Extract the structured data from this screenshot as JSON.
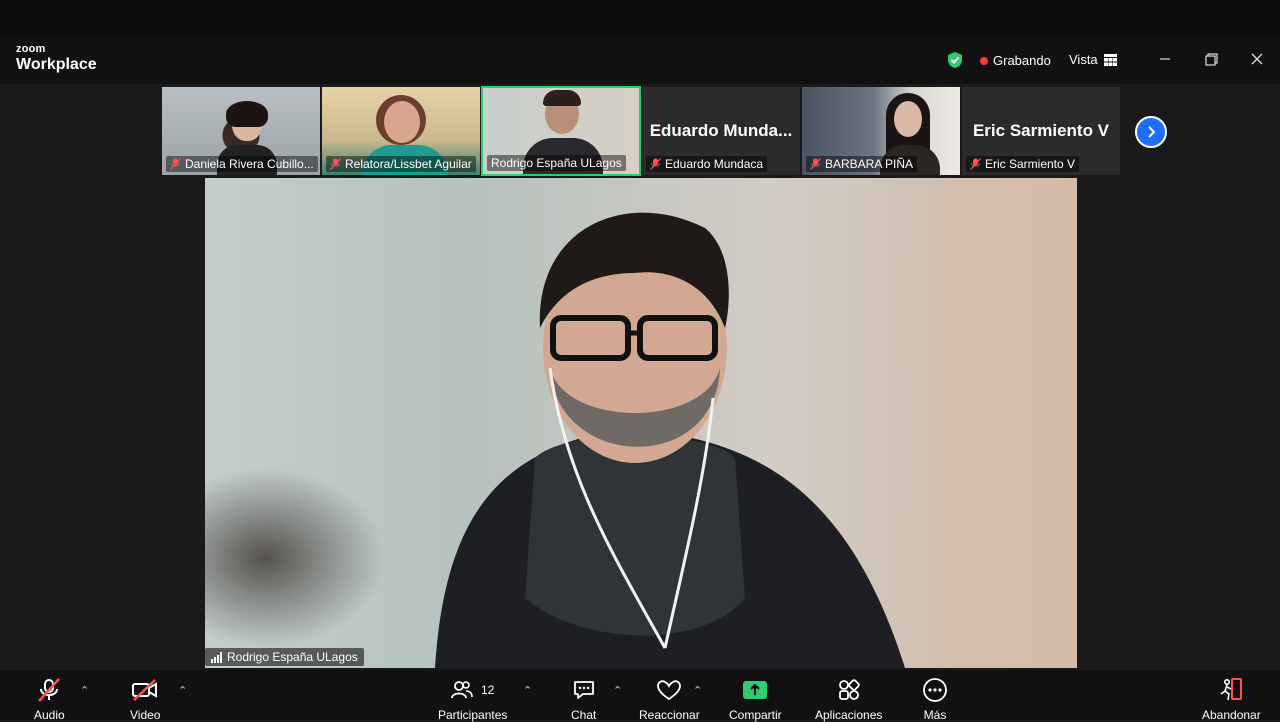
{
  "app": {
    "brand_small": "zoom",
    "brand_large": "Workplace"
  },
  "status": {
    "recording_label": "Grabando",
    "view_label": "Vista",
    "accent_green": "#2ecc71",
    "record_red": "#ff3b3b"
  },
  "participants_strip": [
    {
      "name": "Daniela Rivera Cubillo...",
      "muted": true,
      "video": true
    },
    {
      "name": "Relatora/Lissbet Aguilar",
      "muted": true,
      "video": true
    },
    {
      "name": "Rodrigo España  ULagos",
      "muted": false,
      "video": true,
      "active": true
    },
    {
      "name": "Eduardo Mundaca",
      "display_name": "Eduardo  Munda...",
      "muted": true,
      "video": false
    },
    {
      "name": "BARBARA PIÑA",
      "muted": true,
      "video": true
    },
    {
      "name": "Eric Sarmiento V",
      "display_name": "Eric Sarmiento V",
      "muted": true,
      "video": false
    }
  ],
  "main_video": {
    "speaker_name": "Rodrigo España  ULagos"
  },
  "toolbar": {
    "audio": "Audio",
    "video": "Video",
    "participants": "Participantes",
    "participants_count": "12",
    "chat": "Chat",
    "react": "Reaccionar",
    "share": "Compartir",
    "apps": "Aplicaciones",
    "more": "Más",
    "leave": "Abandonar"
  }
}
